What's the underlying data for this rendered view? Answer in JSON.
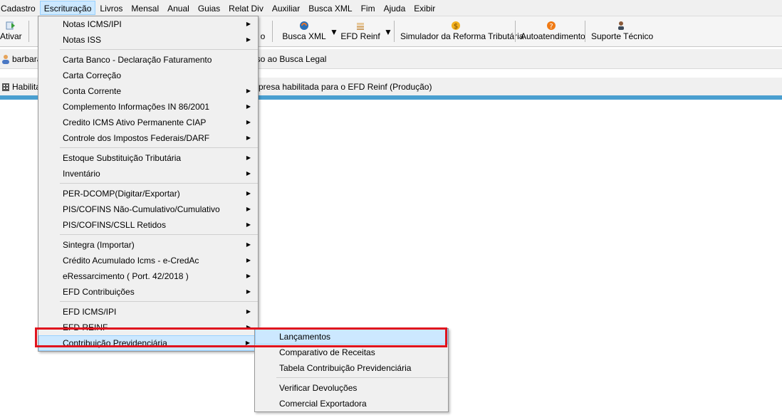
{
  "menubar": {
    "items": [
      {
        "label": "Cadastro"
      },
      {
        "label": "Escrituração"
      },
      {
        "label": "Livros"
      },
      {
        "label": "Mensal"
      },
      {
        "label": "Anual"
      },
      {
        "label": "Guias"
      },
      {
        "label": "Relat Div"
      },
      {
        "label": "Auxiliar"
      },
      {
        "label": "Busca XML"
      },
      {
        "label": "Fim"
      },
      {
        "label": "Ajuda"
      },
      {
        "label": "Exibir"
      }
    ]
  },
  "toolbar": {
    "ativar": "Ativar",
    "partial": "o",
    "busca_xml": "Busca XML",
    "efd_reinf": "EFD Reinf",
    "simulador": "Simulador da Reforma Tributária",
    "autoatendimento": "Autoatendimento",
    "suporte": "Suporte Técnico"
  },
  "infobar": {
    "user": "barbara",
    "user_msg": "esso ao Busca Legal",
    "habilita": "Habilita",
    "habilita_msg": "presa habilitada para o EFD Reinf (Produção)"
  },
  "escrituracao_menu": {
    "items": [
      "Notas ICMS/IPI",
      "Notas ISS",
      "Carta Banco - Declaração Faturamento",
      "Carta Correção",
      "Conta Corrente",
      "Complemento Informações IN 86/2001",
      "Credito ICMS Ativo Permanente CIAP",
      "Controle dos Impostos Federais/DARF",
      "Estoque Substituição Tributária",
      "Inventário",
      "PER-DCOMP(Digitar/Exportar)",
      "PIS/COFINS Não-Cumulativo/Cumulativo",
      "PIS/COFINS/CSLL Retidos",
      "Sintegra (Importar)",
      "Crédito Acumulado Icms - e-CredAc",
      "eRessarcimento ( Port. 42/2018 )",
      "EFD Contribuições",
      "EFD ICMS/IPI",
      "EFD REINF",
      "Contribuição Previdenciária"
    ]
  },
  "contribuicao_submenu": {
    "items": [
      "Lançamentos",
      "Comparativo de Receitas",
      "Tabela Contribuição Previdenciária",
      "Verificar Devoluções",
      "Comercial Exportadora"
    ]
  },
  "icons": {
    "ativar": "refresh-green-icon",
    "busca_xml": "busca-xml-icon",
    "efd_reinf": "stack-icon",
    "simulador": "dollar-coin-icon",
    "autoatendimento": "help-orange-icon",
    "suporte": "support-person-icon",
    "user": "user-icon",
    "habilita": "building-icon"
  },
  "colors": {
    "highlight": "#cce8ff",
    "highlight_border": "#99d1ff",
    "red_annotation": "#e0141e",
    "blue_strip": "#4a9fd0"
  }
}
